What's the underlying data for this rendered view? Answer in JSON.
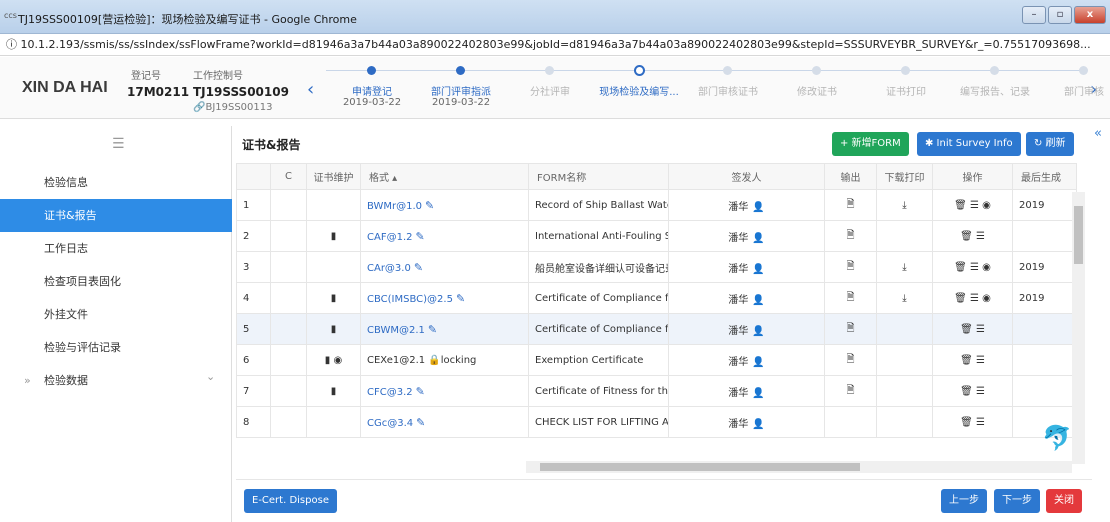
{
  "window": {
    "favicon_text": "ccs",
    "title": "TJ19SSS00109[营运检验]：现场检验及编写证书 - Google Chrome",
    "min_label": "–",
    "max_label": "▫",
    "close_label": "x"
  },
  "address": {
    "info_icon": "ⓘ",
    "url": "10.1.2.193/ssmis/ss/ssIndex/ssFlowFrame?workId=d81946a3a7b44a03a890022402803e99&jobId=d81946a3a7b44a03a890022402803e99&stepId=SSSURVEYBR_SURVEY&r_=0.75517093698..."
  },
  "header": {
    "brand": "XIN DA HAI",
    "reg_label": "登记号",
    "reg_value": "17M0211",
    "ctrl_label": "工作控制号",
    "ctrl_value": "TJ19SSS00109",
    "ctrl_sub": "BJ19SS00113",
    "prev_arrow": "‹",
    "next_arrow": "›",
    "steps": [
      {
        "label": "申请登记",
        "date": "2019-03-22",
        "state": "done"
      },
      {
        "label": "部门评审指派",
        "date": "2019-03-22",
        "state": "done"
      },
      {
        "label": "分社评审",
        "date": "",
        "state": "todo"
      },
      {
        "label": "现场检验及编写...",
        "date": "",
        "state": "current"
      },
      {
        "label": "部门审核证书",
        "date": "",
        "state": "todo"
      },
      {
        "label": "修改证书",
        "date": "",
        "state": "todo"
      },
      {
        "label": "证书打印",
        "date": "",
        "state": "todo"
      },
      {
        "label": "编写报告、记录",
        "date": "",
        "state": "todo"
      },
      {
        "label": "部门审核",
        "date": "",
        "state": "todo"
      }
    ]
  },
  "sidebar": {
    "collapse_icon": "☰",
    "items": [
      {
        "label": "检验信息",
        "active": false
      },
      {
        "label": "证书&报告",
        "active": true
      },
      {
        "label": "工作日志",
        "active": false
      },
      {
        "label": "检查项目表固化",
        "active": false
      },
      {
        "label": "外挂文件",
        "active": false
      },
      {
        "label": "检验与评估记录",
        "active": false
      },
      {
        "label": "检验数据",
        "active": false
      }
    ],
    "expand_prefix": "»",
    "expand_chevron": "⌄"
  },
  "main": {
    "title": "证书&报告",
    "btn_new": "+ 新增FORM",
    "btn_init": "✱ Init Survey Info",
    "btn_refresh": "↻ 刷新",
    "collapse_right": "«",
    "columns": [
      "",
      "C",
      "证书维护",
      "格式 ▴",
      "FORM名称",
      "签发人",
      "输出",
      "下载打印",
      "操作",
      "最后生成"
    ],
    "rows": [
      {
        "no": "1",
        "maint": "",
        "fmt": "BWMr@1.0",
        "edit": true,
        "name": "Record of Ship Ballast Water I",
        "signer": "潘华",
        "out": true,
        "dl": true,
        "ops": "🗑 ☰ ◉",
        "last": "2019"
      },
      {
        "no": "2",
        "maint": "▮",
        "fmt": "CAF@1.2",
        "edit": true,
        "name": "International Anti-Fouling Sys",
        "signer": "潘华",
        "out": true,
        "dl": false,
        "ops": "🗑 ☰",
        "last": ""
      },
      {
        "no": "3",
        "maint": "",
        "fmt": "CAr@3.0",
        "edit": true,
        "name": "船员舱室设备详细认可设备记录",
        "signer": "潘华",
        "out": true,
        "dl": true,
        "ops": "🗑 ☰ ◉",
        "last": "2019"
      },
      {
        "no": "4",
        "maint": "▮",
        "fmt": "CBC(IMSBC)@2.5",
        "edit": true,
        "name": "Certificate of Compliance for",
        "signer": "潘华",
        "out": true,
        "dl": true,
        "ops": "🗑 ☰ ◉",
        "last": "2019"
      },
      {
        "no": "5",
        "maint": "▮",
        "fmt": "CBWM@2.1",
        "edit": true,
        "name": "Certificate of Compliance for",
        "signer": "潘华",
        "out": true,
        "dl": false,
        "ops": "🗑 ☰",
        "last": ""
      },
      {
        "no": "6",
        "maint": "▮ ◉",
        "fmt": "CEXe1@2.1 🔒locking",
        "edit": false,
        "name": "Exemption Certificate",
        "signer": "潘华",
        "out": true,
        "dl": false,
        "ops": "🗑 ☰",
        "last": ""
      },
      {
        "no": "7",
        "maint": "▮",
        "fmt": "CFC@3.2",
        "edit": true,
        "name": "Certificate of Fitness for the C",
        "signer": "潘华",
        "out": true,
        "dl": false,
        "ops": "🗑 ☰",
        "last": ""
      },
      {
        "no": "8",
        "maint": "",
        "fmt": "CGc@3.4",
        "edit": true,
        "name": "CHECK LIST FOR LIFTING APP",
        "signer": "潘华",
        "out": false,
        "dl": false,
        "ops": "🗑 ☰",
        "last": ""
      }
    ],
    "btn_ecert": "E-Cert. Dispose",
    "btn_prev": "上一步",
    "btn_next": "下一步",
    "btn_close": "关闭"
  },
  "colors": {
    "accent": "#2e8ce6",
    "green": "#20a55a",
    "blue": "#2d78d0",
    "red": "#e4393c"
  }
}
